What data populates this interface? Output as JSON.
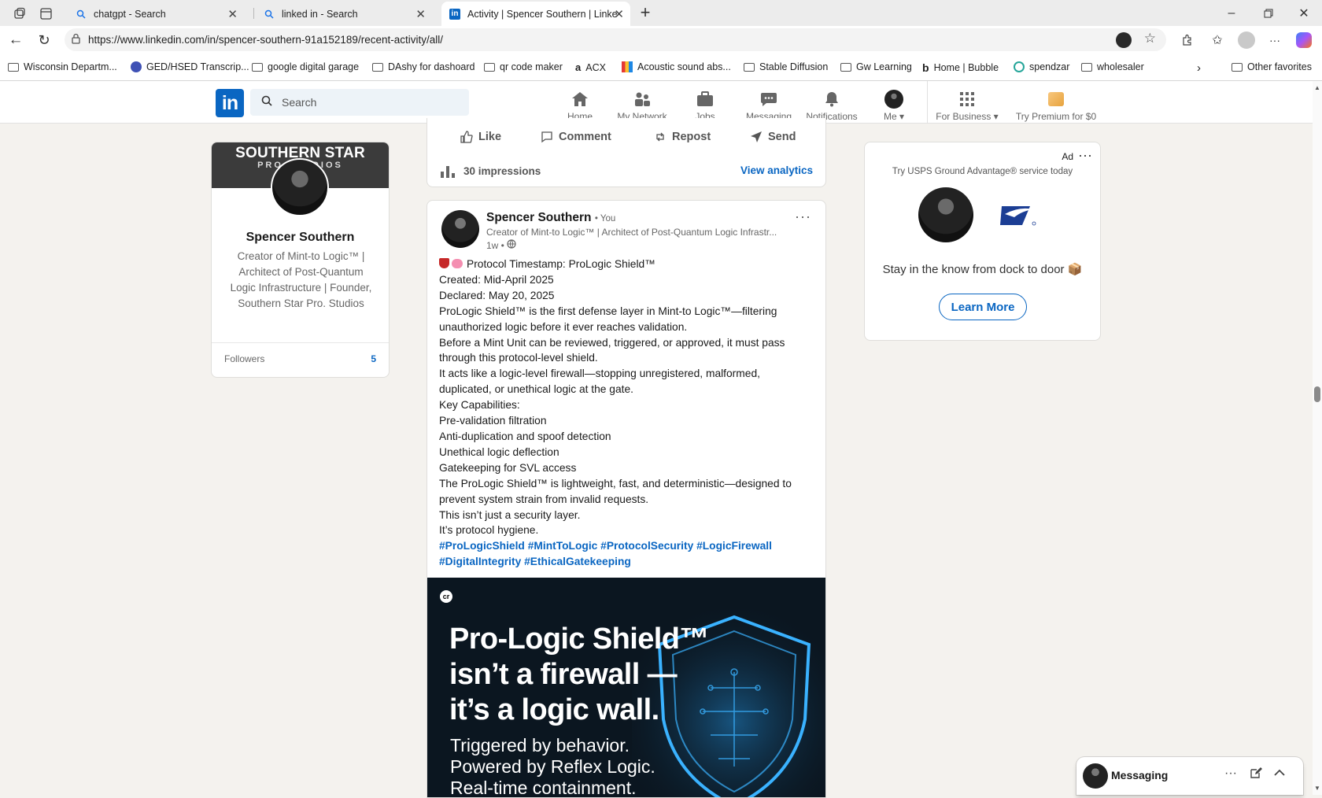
{
  "browser": {
    "tabs": [
      {
        "title": "chatgpt - Search",
        "icon": "search-icon"
      },
      {
        "title": "linked in - Search",
        "icon": "search-icon"
      },
      {
        "title": "Activity | Spencer Southern | Linke",
        "icon": "linkedin-icon"
      }
    ],
    "url": "https://www.linkedin.com/in/spencer-southern-91a152189/recent-activity/all/",
    "bookmarks": [
      "Wisconsin Departm...",
      "GED/HSED Transcrip...",
      "google digital garage",
      "DAshy for dashoard",
      "qr code maker",
      "ACX",
      "Acoustic sound abs...",
      "Stable Diffusion",
      "Gw Learning",
      "Home | Bubble",
      "spendzar",
      "wholesaler"
    ],
    "other_favorites": "Other favorites"
  },
  "nav": {
    "search_placeholder": "Search",
    "items": [
      "Home",
      "My Network",
      "Jobs",
      "Messaging",
      "Notifications",
      "Me"
    ],
    "for_business": "For Business",
    "premium": "Try Premium for $0"
  },
  "profile": {
    "banner_line1": "SOUTHERN STAR",
    "banner_line2": "PRO STUDIOS",
    "name": "Spencer Southern",
    "headline": "Creator of Mint-to Logic™ | Architect of Post-Quantum Logic Infrastructure | Founder, Southern Star Pro. Studios",
    "followers_label": "Followers",
    "followers_count": "5"
  },
  "prev_post": {
    "actions": [
      "Like",
      "Comment",
      "Repost",
      "Send"
    ],
    "impressions": "30 impressions",
    "analytics": "View analytics"
  },
  "post": {
    "author": "Spencer Southern",
    "you": "• You",
    "headline": "Creator of Mint-to Logic™ | Architect of Post-Quantum Logic Infrastr...",
    "time": "1w •",
    "lines": [
      "Protocol Timestamp: ProLogic Shield™",
      " Created: Mid-April 2025",
      " Declared: May 20, 2025",
      "ProLogic Shield™ is the first defense layer in Mint-to Logic™—filtering",
      "unauthorized logic before it ever reaches validation.",
      "Before a Mint Unit can be reviewed, triggered, or approved, it must pass",
      "through this protocol-level shield.",
      " It acts like a logic-level firewall—stopping unregistered, malformed,",
      "duplicated, or unethical logic at the gate.",
      "Key Capabilities:",
      "Pre-validation filtration",
      "Anti-duplication and spoof detection",
      "Unethical logic deflection",
      "Gatekeeping for SVL access",
      "The ProLogic Shield™ is lightweight, fast, and deterministic—designed to",
      "prevent system strain from invalid requests.",
      "This isn’t just a security layer.",
      " It’s protocol hygiene."
    ],
    "hashtags_line1": "#ProLogicShield #MintToLogic #ProtocolSecurity #LogicFirewall",
    "hashtags_line2": "#DigitalIntegrity #EthicalGatekeeping",
    "image_badge": "cr",
    "image_headline": [
      "Pro-Logic Shield™",
      "isn’t a firewall —",
      "it’s a logic wall."
    ],
    "image_sub": [
      "Triggered by behavior.",
      "Powered by Reflex Logic.",
      "Real-time containment."
    ]
  },
  "ad": {
    "label": "Ad",
    "tagline": "Try USPS Ground Advantage® service today",
    "text": "Stay in the know from dock to door 📦",
    "cta": "Learn More"
  },
  "messaging": {
    "label": "Messaging"
  },
  "colors": {
    "linkedin_blue": "#0a66c2",
    "page_bg": "#f4f2ee",
    "usps_blue": "#1c3e94"
  }
}
